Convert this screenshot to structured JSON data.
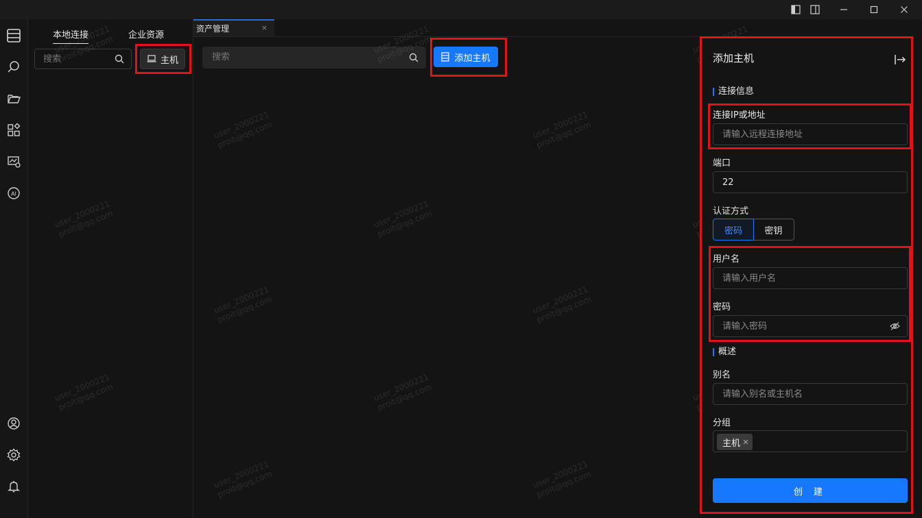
{
  "sidebar_tabs": [
    {
      "label": "本地连接",
      "active": true
    },
    {
      "label": "企业资源",
      "active": false
    }
  ],
  "left_search": {
    "placeholder": "搜索"
  },
  "host_button": {
    "label": "主机"
  },
  "doc_tab": {
    "label": "资产管理",
    "close": "×"
  },
  "main_search": {
    "placeholder": "搜索"
  },
  "add_host_button": {
    "label": "添加主机"
  },
  "drawer": {
    "title": "添加主机",
    "section_connection": "连接信息",
    "ip_label": "连接IP或地址",
    "ip_placeholder": "请输入远程连接地址",
    "port_label": "端口",
    "port_value": "22",
    "auth_label": "认证方式",
    "auth_options": [
      "密码",
      "密钥"
    ],
    "auth_selected": "密码",
    "username_label": "用户名",
    "username_placeholder": "请输入用户名",
    "password_label": "密码",
    "password_placeholder": "请输入密码",
    "section_overview": "概述",
    "alias_label": "别名",
    "alias_placeholder": "请输入别名或主机名",
    "group_label": "分组",
    "group_tag": "主机",
    "create_label": "创 建"
  },
  "watermark": {
    "line1": "user_2000221",
    "line2": "proit@qq.com"
  },
  "colors": {
    "accent": "#1677ff",
    "highlight": "#e0131b",
    "background": "#141414"
  }
}
